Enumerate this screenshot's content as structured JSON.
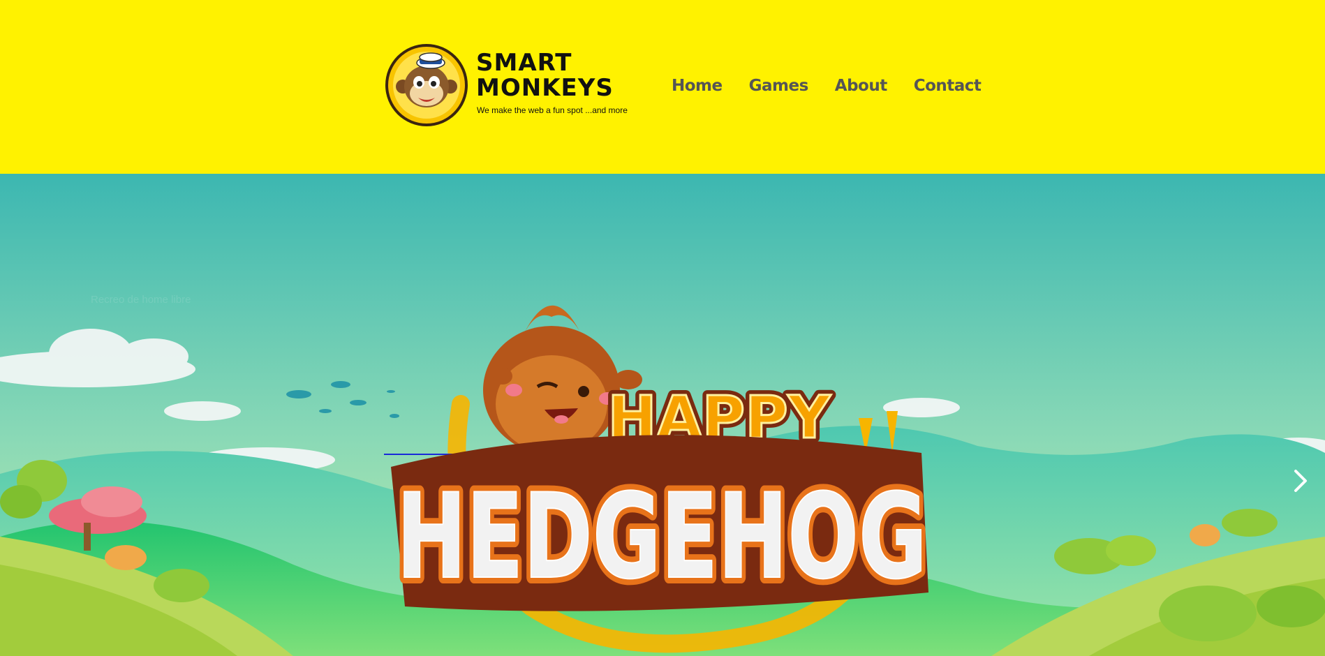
{
  "header": {
    "logo": {
      "title_line1": "SMART",
      "title_line2": "MONKEYS",
      "tagline": "We make the web a fun spot ...and more",
      "icon": "monkey-sailor-icon"
    },
    "nav": [
      {
        "label": "Home"
      },
      {
        "label": "Games"
      },
      {
        "label": "About"
      },
      {
        "label": "Contact"
      }
    ]
  },
  "hero": {
    "caption": "Recreo de home libre",
    "game_title_line1": "HAPPY",
    "game_title_line2": "HEDGEHOG",
    "next_icon": "chevron-right-icon"
  },
  "colors": {
    "header_bg": "#fff200",
    "nav_text": "#555555",
    "sky_top": "#3cb7b1",
    "sky_bottom": "#b5e8a8",
    "title_orange": "#f7a100",
    "title_brown": "#7a2a10"
  }
}
